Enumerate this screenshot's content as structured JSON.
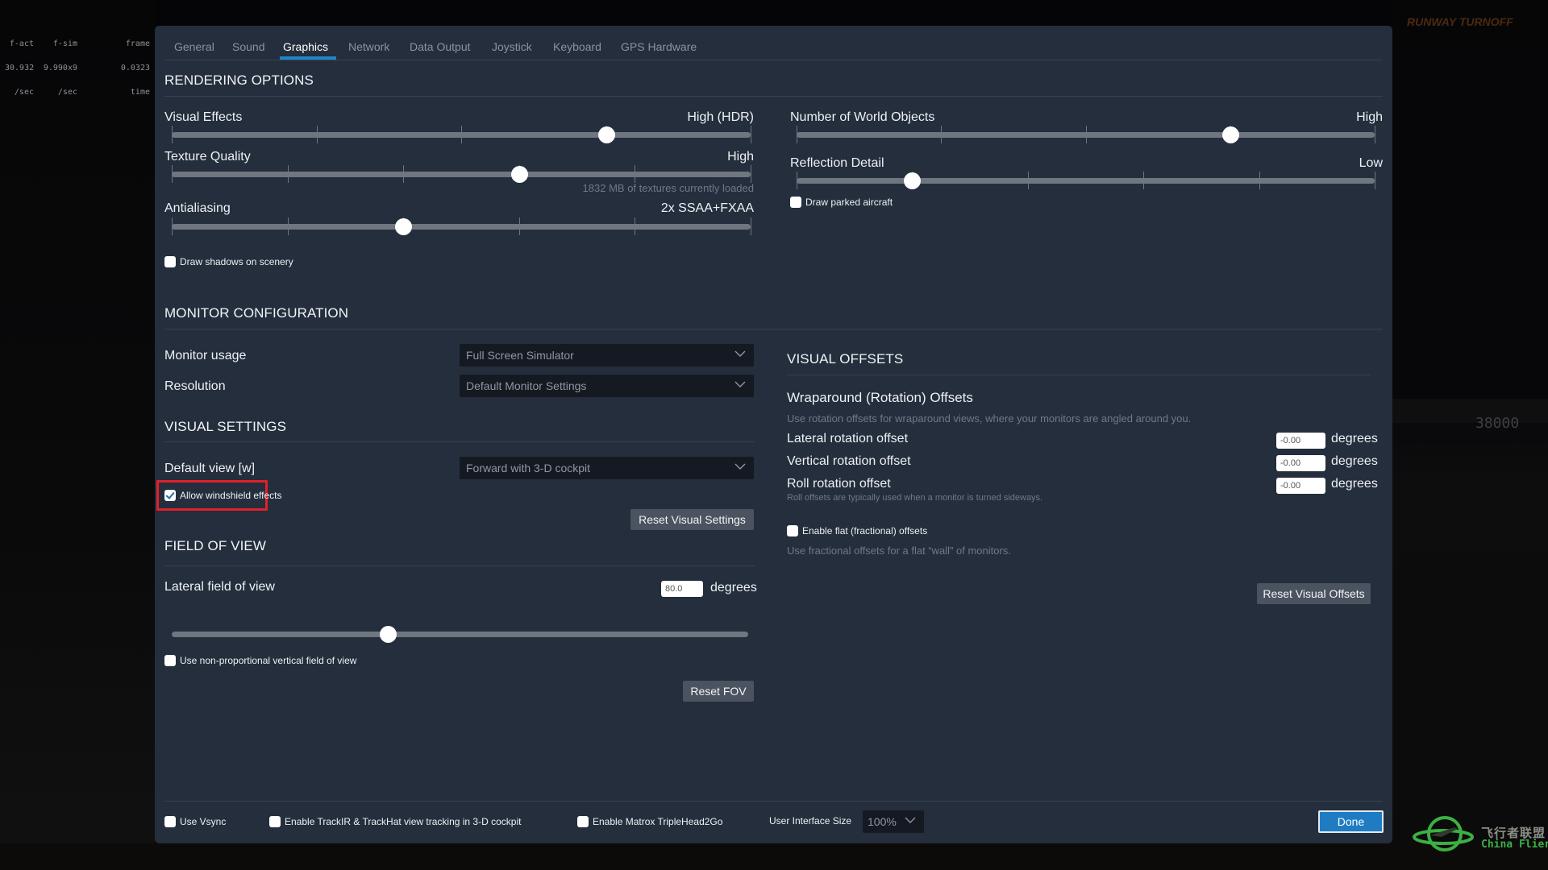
{
  "perf_stats": [
    {
      "line1": "f-act",
      "line2": "30.932",
      "line3": "/sec"
    },
    {
      "line1": "f-sim",
      "line2": "9.990x9",
      "line3": "/sec"
    },
    {
      "line1": "frame",
      "line2": "0.0323",
      "line3": "time"
    }
  ],
  "background": {
    "altitude_readout": "38000",
    "taxi_sign": "RUNWAY TURNOFF"
  },
  "tabs": [
    {
      "label": "General",
      "active": false
    },
    {
      "label": "Sound",
      "active": false
    },
    {
      "label": "Graphics",
      "active": true
    },
    {
      "label": "Network",
      "active": false
    },
    {
      "label": "Data Output",
      "active": false
    },
    {
      "label": "Joystick",
      "active": false
    },
    {
      "label": "Keyboard",
      "active": false
    },
    {
      "label": "GPS Hardware",
      "active": false
    }
  ],
  "rendering": {
    "title": "RENDERING OPTIONS",
    "visual_effects": {
      "label": "Visual Effects",
      "value": "High (HDR)",
      "level": 0.75,
      "steps": 4
    },
    "texture_quality": {
      "label": "Texture Quality",
      "value": "High",
      "level": 0.6,
      "steps": 5,
      "note": "1832 MB of textures currently loaded"
    },
    "antialiasing": {
      "label": "Antialiasing",
      "value": "2x SSAA+FXAA",
      "level": 0.4,
      "steps": 5
    },
    "draw_shadows": {
      "label": "Draw shadows on scenery",
      "checked": false
    },
    "world_objects": {
      "label": "Number of World Objects",
      "value": "High",
      "level": 0.75,
      "steps": 4
    },
    "reflection_detail": {
      "label": "Reflection Detail",
      "value": "Low",
      "level": 0.2,
      "steps": 5
    },
    "draw_parked_aircraft": {
      "label": "Draw parked aircraft",
      "checked": false
    }
  },
  "monitor": {
    "title": "MONITOR CONFIGURATION",
    "usage_label": "Monitor usage",
    "usage_value": "Full Screen Simulator",
    "resolution_label": "Resolution",
    "resolution_value": "Default Monitor Settings"
  },
  "visual_settings": {
    "title": "VISUAL SETTINGS",
    "default_view_label": "Default view [w]",
    "default_view_value": "Forward with 3-D cockpit",
    "windshield": {
      "label": "Allow windshield effects",
      "checked": true
    },
    "reset_label": "Reset Visual Settings"
  },
  "fov": {
    "title": "FIELD OF VIEW",
    "lateral_label": "Lateral field of view",
    "lateral_value": "80.0",
    "unit": "degrees",
    "level": 0.375,
    "non_proportional": {
      "label": "Use non-proportional vertical field of view",
      "checked": false
    },
    "reset_label": "Reset FOV"
  },
  "visual_offsets": {
    "title": "VISUAL OFFSETS",
    "wrap_title": "Wraparound (Rotation) Offsets",
    "wrap_hint": "Use rotation offsets for wraparound views, where your monitors are angled around you.",
    "lateral": {
      "label": "Lateral rotation offset",
      "value": "-0.00",
      "unit": "degrees"
    },
    "vertical": {
      "label": "Vertical rotation offset",
      "value": "-0.00",
      "unit": "degrees"
    },
    "roll": {
      "label": "Roll rotation offset",
      "value": "-0.00",
      "unit": "degrees",
      "hint": "Roll offsets are typically used when a monitor is turned sideways."
    },
    "flat": {
      "label": "Enable flat (fractional) offsets",
      "checked": false,
      "hint": "Use fractional offsets for a flat “wall” of monitors."
    },
    "reset_label": "Reset Visual Offsets"
  },
  "footer": {
    "vsync": {
      "label": "Use Vsync",
      "checked": false
    },
    "trackir": {
      "label": "Enable TrackIR & TrackHat view tracking in 3-D cockpit",
      "checked": false
    },
    "matrox": {
      "label": "Enable Matrox TripleHead2Go",
      "checked": false
    },
    "ui_size_label": "User Interface Size",
    "ui_size_value": "100%",
    "done_label": "Done"
  },
  "watermark": {
    "chinese": "飞行者联盟",
    "english": "China Flier"
  },
  "colors": {
    "accent": "#1f86c8",
    "done_button": "#1f7cc2",
    "panel": "#242e3c",
    "highlight": "#e0202a",
    "watermark_green": "#3cb043"
  }
}
